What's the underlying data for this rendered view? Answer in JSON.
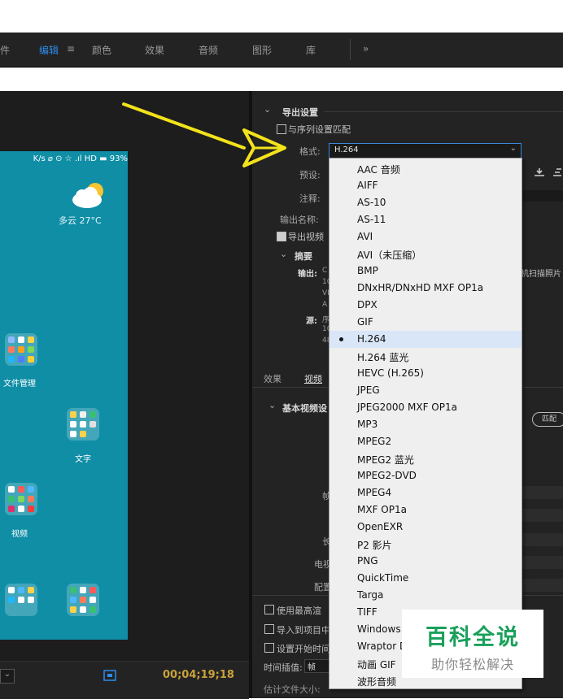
{
  "tabs": [
    {
      "label": "件"
    },
    {
      "label": "编辑"
    },
    {
      "label": "≡"
    },
    {
      "label": "颜色"
    },
    {
      "label": "效果"
    },
    {
      "label": "音频"
    },
    {
      "label": "图形"
    },
    {
      "label": "库"
    },
    {
      "label": "»"
    }
  ],
  "phone": {
    "status_text": "K/s ⌀ ⊙ ☆ .ıl HD ▬ 93%",
    "weather": "多云 27°C",
    "apps": [
      "文件管理",
      "文字",
      "视频"
    ]
  },
  "timeline": {
    "timecode": "00;04;19;18",
    "dropdown_arrow": "⌄"
  },
  "export": {
    "section_title": "导出设置",
    "match_sequence_label": "与序列设置匹配",
    "format_label": "格式:",
    "format_value": "H.264",
    "preset_label": "预设:",
    "comments_label": "注释:",
    "output_name_label": "输出名称:",
    "export_video_label": "导出视频",
    "summary_title": "摘要",
    "output_label": "输出:",
    "output_lines": [
      "C",
      "10",
      "VE",
      "A"
    ],
    "source_label": "源:",
    "source_lines": [
      "序",
      "10",
      "48"
    ],
    "right_clip_text": "机扫描照片"
  },
  "lower_tabs": [
    "效果",
    "视频"
  ],
  "basic_video": {
    "title": "基本视频设",
    "match_button": "匹配",
    "labels": [
      "帧",
      "长",
      "电视",
      "配置"
    ]
  },
  "format_menu": {
    "selected": "H.264",
    "items": [
      "AAC 音频",
      "AIFF",
      "AS-10",
      "AS-11",
      "AVI",
      "AVI（未压缩）",
      "BMP",
      "DNxHR/DNxHD MXF OP1a",
      "DPX",
      "GIF",
      "H.264",
      "H.264 蓝光",
      "HEVC (H.265)",
      "JPEG",
      "JPEG2000 MXF OP1a",
      "MP3",
      "MPEG2",
      "MPEG2 蓝光",
      "MPEG2-DVD",
      "MPEG4",
      "MXF OP1a",
      "OpenEXR",
      "P2 影片",
      "PNG",
      "QuickTime",
      "Targa",
      "TIFF",
      "Windows I",
      "Wraptor D",
      "动画 GIF",
      "波形音频"
    ]
  },
  "bottom_options": {
    "use_max_render": "使用最高渲",
    "import_to_project": "导入到项目中",
    "set_start_time": "设置开始时间",
    "time_interp_label": "时间插值:",
    "time_interp_value": "帧",
    "est_size_label": "估计文件大小:"
  },
  "watermark": {
    "line1": "百科全说",
    "line2": "助你轻松解决"
  },
  "colors": {
    "accent": "#2d8ceb",
    "arrow": "#f2e31b",
    "watermark_green": "#19a05a"
  }
}
